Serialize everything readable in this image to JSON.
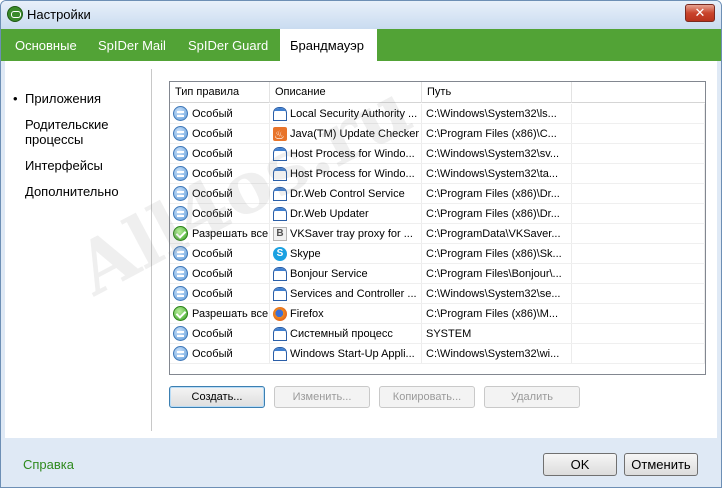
{
  "window": {
    "title": "Настройки",
    "close_label": "✕"
  },
  "tabs": [
    {
      "label": "Основные"
    },
    {
      "label": "SpIDer Mail"
    },
    {
      "label": "SpIDer Guard"
    },
    {
      "label": "Брандмауэр"
    }
  ],
  "nav": [
    {
      "label": "Приложения"
    },
    {
      "label": "Родительские процессы"
    },
    {
      "label": "Интерфейсы"
    },
    {
      "label": "Дополнительно"
    }
  ],
  "table": {
    "columns": [
      "Тип правила",
      "Описание",
      "Путь"
    ],
    "rows": [
      {
        "rule": "Особый",
        "rule_icon": "custom-rule-icon",
        "desc": "Local Security Authority ...",
        "app_icon": "window-icon",
        "path": "C:\\Windows\\System32\\ls..."
      },
      {
        "rule": "Особый",
        "rule_icon": "custom-rule-icon",
        "desc": "Java(TM) Update Checker",
        "app_icon": "java-icon",
        "path": "C:\\Program Files (x86)\\C..."
      },
      {
        "rule": "Особый",
        "rule_icon": "custom-rule-icon",
        "desc": "Host Process for Windo...",
        "app_icon": "window-icon",
        "path": "C:\\Windows\\System32\\sv..."
      },
      {
        "rule": "Особый",
        "rule_icon": "custom-rule-icon",
        "desc": "Host Process for Windo...",
        "app_icon": "window-icon",
        "path": "C:\\Windows\\System32\\ta..."
      },
      {
        "rule": "Особый",
        "rule_icon": "custom-rule-icon",
        "desc": "Dr.Web Control Service",
        "app_icon": "window-icon",
        "path": "C:\\Program Files (x86)\\Dr..."
      },
      {
        "rule": "Особый",
        "rule_icon": "custom-rule-icon",
        "desc": "Dr.Web Updater",
        "app_icon": "window-icon",
        "path": "C:\\Program Files (x86)\\Dr..."
      },
      {
        "rule": "Разрешать все",
        "rule_icon": "allow-rule-icon",
        "desc": "VKSaver tray proxy for ...",
        "app_icon": "vk-icon",
        "path": "C:\\ProgramData\\VKSaver..."
      },
      {
        "rule": "Особый",
        "rule_icon": "custom-rule-icon",
        "desc": "Skype",
        "app_icon": "skype-icon",
        "path": "C:\\Program Files (x86)\\Sk..."
      },
      {
        "rule": "Особый",
        "rule_icon": "custom-rule-icon",
        "desc": "Bonjour Service",
        "app_icon": "window-icon",
        "path": "C:\\Program Files\\Bonjour\\..."
      },
      {
        "rule": "Особый",
        "rule_icon": "custom-rule-icon",
        "desc": "Services and Controller ...",
        "app_icon": "window-icon",
        "path": "C:\\Windows\\System32\\se..."
      },
      {
        "rule": "Разрешать все",
        "rule_icon": "allow-rule-icon",
        "desc": "Firefox",
        "app_icon": "firefox-icon",
        "path": "C:\\Program Files (x86)\\M..."
      },
      {
        "rule": "Особый",
        "rule_icon": "custom-rule-icon",
        "desc": "Системный процесс",
        "app_icon": "window-icon",
        "path": "SYSTEM"
      },
      {
        "rule": "Особый",
        "rule_icon": "custom-rule-icon",
        "desc": "Windows Start-Up Appli...",
        "app_icon": "window-icon",
        "path": "C:\\Windows\\System32\\wi..."
      }
    ]
  },
  "actions": {
    "create": "Создать...",
    "edit": "Изменить...",
    "copy": "Копировать...",
    "delete": "Удалить"
  },
  "footer": {
    "help": "Справка",
    "ok": "OK",
    "cancel": "Отменить"
  },
  "watermark": "All4os.ru",
  "colors": {
    "accent": "#52a336",
    "help_link": "#2f8a1e",
    "window_bg": "#dfe9f5"
  }
}
